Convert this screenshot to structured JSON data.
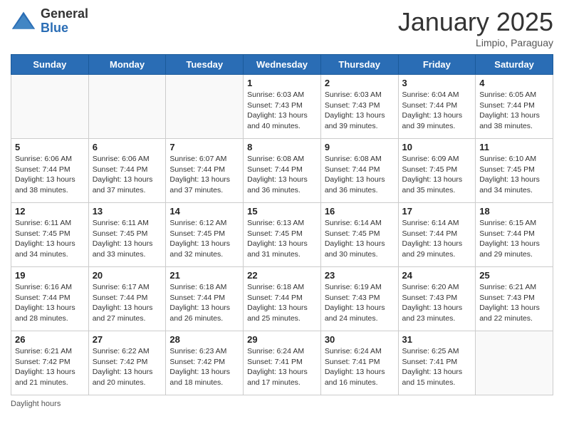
{
  "header": {
    "logo_general": "General",
    "logo_blue": "Blue",
    "title": "January 2025",
    "subtitle": "Limpio, Paraguay"
  },
  "days_of_week": [
    "Sunday",
    "Monday",
    "Tuesday",
    "Wednesday",
    "Thursday",
    "Friday",
    "Saturday"
  ],
  "weeks": [
    [
      {
        "date": "",
        "info": ""
      },
      {
        "date": "",
        "info": ""
      },
      {
        "date": "",
        "info": ""
      },
      {
        "date": "1",
        "sunrise": "6:03 AM",
        "sunset": "7:43 PM",
        "daylight": "13 hours and 40 minutes."
      },
      {
        "date": "2",
        "sunrise": "6:03 AM",
        "sunset": "7:43 PM",
        "daylight": "13 hours and 39 minutes."
      },
      {
        "date": "3",
        "sunrise": "6:04 AM",
        "sunset": "7:44 PM",
        "daylight": "13 hours and 39 minutes."
      },
      {
        "date": "4",
        "sunrise": "6:05 AM",
        "sunset": "7:44 PM",
        "daylight": "13 hours and 38 minutes."
      }
    ],
    [
      {
        "date": "5",
        "sunrise": "6:06 AM",
        "sunset": "7:44 PM",
        "daylight": "13 hours and 38 minutes."
      },
      {
        "date": "6",
        "sunrise": "6:06 AM",
        "sunset": "7:44 PM",
        "daylight": "13 hours and 37 minutes."
      },
      {
        "date": "7",
        "sunrise": "6:07 AM",
        "sunset": "7:44 PM",
        "daylight": "13 hours and 37 minutes."
      },
      {
        "date": "8",
        "sunrise": "6:08 AM",
        "sunset": "7:44 PM",
        "daylight": "13 hours and 36 minutes."
      },
      {
        "date": "9",
        "sunrise": "6:08 AM",
        "sunset": "7:44 PM",
        "daylight": "13 hours and 36 minutes."
      },
      {
        "date": "10",
        "sunrise": "6:09 AM",
        "sunset": "7:45 PM",
        "daylight": "13 hours and 35 minutes."
      },
      {
        "date": "11",
        "sunrise": "6:10 AM",
        "sunset": "7:45 PM",
        "daylight": "13 hours and 34 minutes."
      }
    ],
    [
      {
        "date": "12",
        "sunrise": "6:11 AM",
        "sunset": "7:45 PM",
        "daylight": "13 hours and 34 minutes."
      },
      {
        "date": "13",
        "sunrise": "6:11 AM",
        "sunset": "7:45 PM",
        "daylight": "13 hours and 33 minutes."
      },
      {
        "date": "14",
        "sunrise": "6:12 AM",
        "sunset": "7:45 PM",
        "daylight": "13 hours and 32 minutes."
      },
      {
        "date": "15",
        "sunrise": "6:13 AM",
        "sunset": "7:45 PM",
        "daylight": "13 hours and 31 minutes."
      },
      {
        "date": "16",
        "sunrise": "6:14 AM",
        "sunset": "7:45 PM",
        "daylight": "13 hours and 30 minutes."
      },
      {
        "date": "17",
        "sunrise": "6:14 AM",
        "sunset": "7:44 PM",
        "daylight": "13 hours and 29 minutes."
      },
      {
        "date": "18",
        "sunrise": "6:15 AM",
        "sunset": "7:44 PM",
        "daylight": "13 hours and 29 minutes."
      }
    ],
    [
      {
        "date": "19",
        "sunrise": "6:16 AM",
        "sunset": "7:44 PM",
        "daylight": "13 hours and 28 minutes."
      },
      {
        "date": "20",
        "sunrise": "6:17 AM",
        "sunset": "7:44 PM",
        "daylight": "13 hours and 27 minutes."
      },
      {
        "date": "21",
        "sunrise": "6:18 AM",
        "sunset": "7:44 PM",
        "daylight": "13 hours and 26 minutes."
      },
      {
        "date": "22",
        "sunrise": "6:18 AM",
        "sunset": "7:44 PM",
        "daylight": "13 hours and 25 minutes."
      },
      {
        "date": "23",
        "sunrise": "6:19 AM",
        "sunset": "7:43 PM",
        "daylight": "13 hours and 24 minutes."
      },
      {
        "date": "24",
        "sunrise": "6:20 AM",
        "sunset": "7:43 PM",
        "daylight": "13 hours and 23 minutes."
      },
      {
        "date": "25",
        "sunrise": "6:21 AM",
        "sunset": "7:43 PM",
        "daylight": "13 hours and 22 minutes."
      }
    ],
    [
      {
        "date": "26",
        "sunrise": "6:21 AM",
        "sunset": "7:42 PM",
        "daylight": "13 hours and 21 minutes."
      },
      {
        "date": "27",
        "sunrise": "6:22 AM",
        "sunset": "7:42 PM",
        "daylight": "13 hours and 20 minutes."
      },
      {
        "date": "28",
        "sunrise": "6:23 AM",
        "sunset": "7:42 PM",
        "daylight": "13 hours and 18 minutes."
      },
      {
        "date": "29",
        "sunrise": "6:24 AM",
        "sunset": "7:41 PM",
        "daylight": "13 hours and 17 minutes."
      },
      {
        "date": "30",
        "sunrise": "6:24 AM",
        "sunset": "7:41 PM",
        "daylight": "13 hours and 16 minutes."
      },
      {
        "date": "31",
        "sunrise": "6:25 AM",
        "sunset": "7:41 PM",
        "daylight": "13 hours and 15 minutes."
      },
      {
        "date": "",
        "info": ""
      }
    ]
  ],
  "footer": {
    "daylight_label": "Daylight hours"
  }
}
